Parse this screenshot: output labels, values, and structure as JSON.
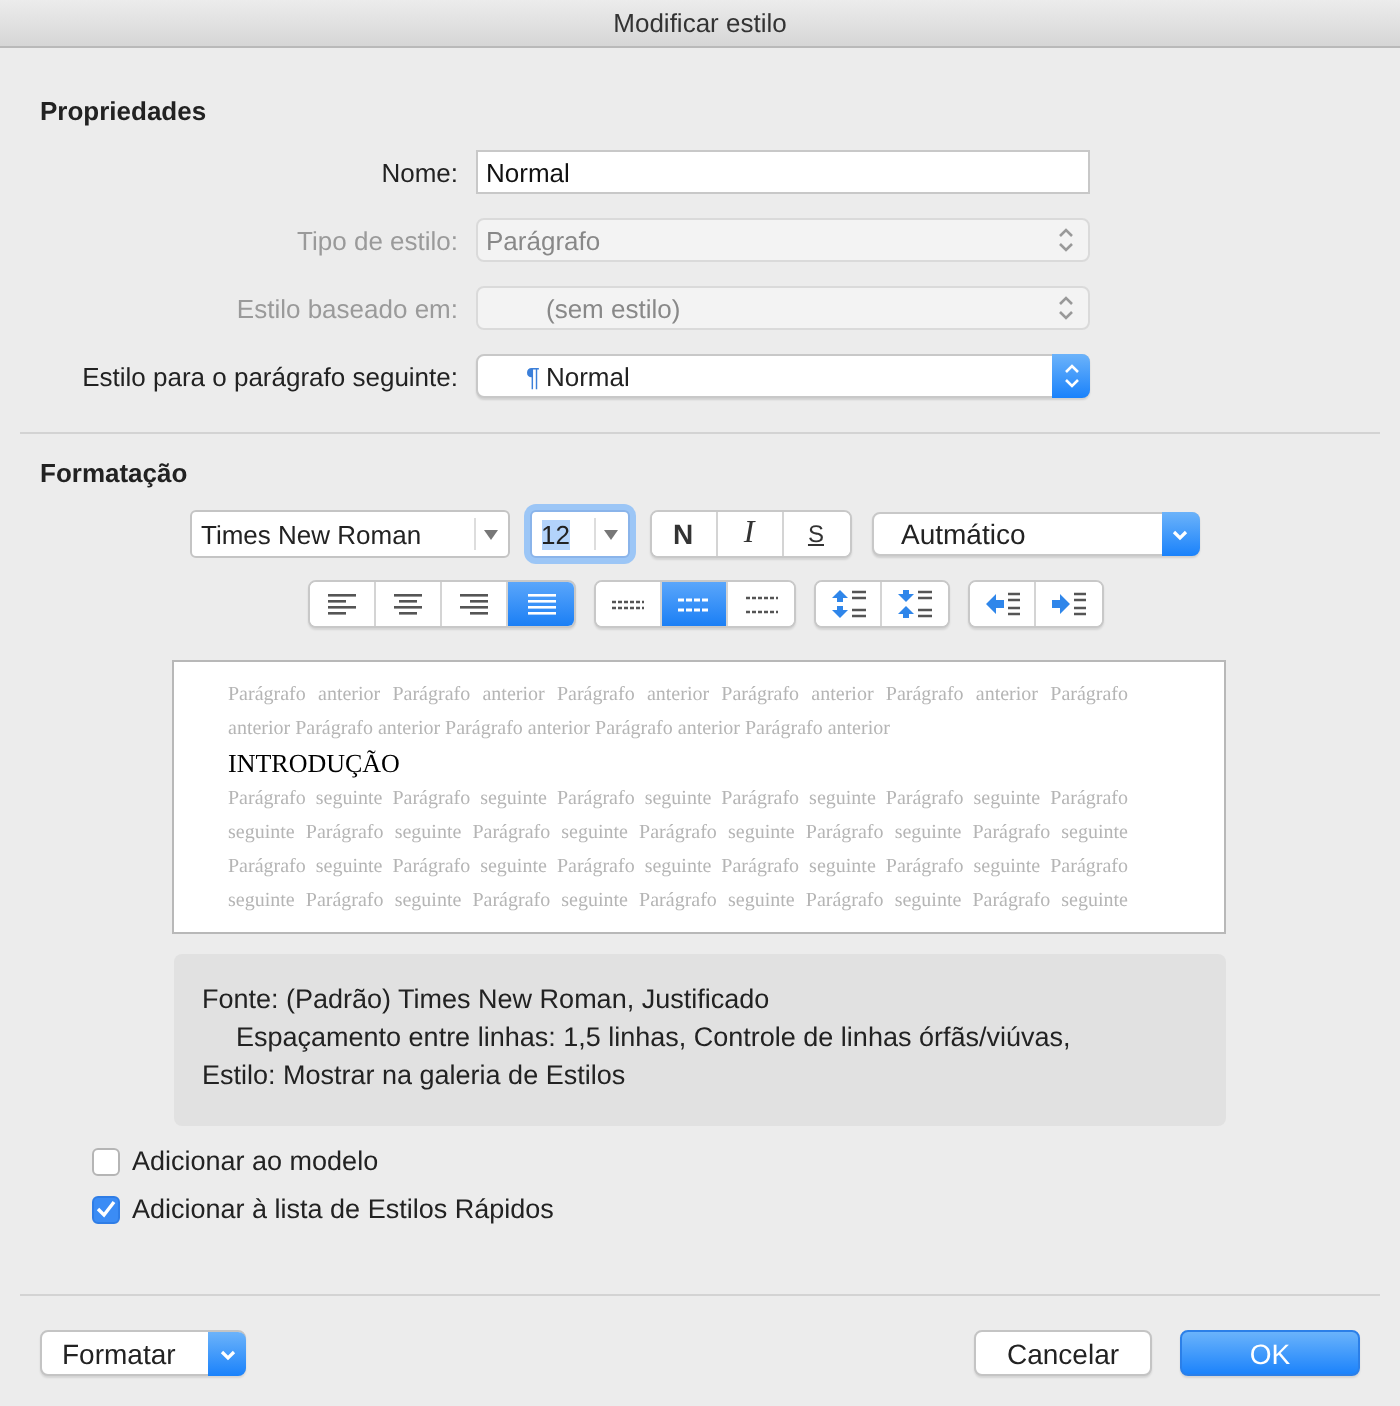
{
  "window": {
    "title": "Modificar estilo"
  },
  "properties": {
    "heading": "Propriedades",
    "fields": [
      {
        "label": "Nome:",
        "kind": "text",
        "value": "Normal"
      },
      {
        "label": "Tipo de estilo:",
        "kind": "select",
        "value": "Parágrafo",
        "disabled": true
      },
      {
        "label": "Estilo baseado em:",
        "kind": "select",
        "value": "(sem estilo)",
        "disabled": true
      },
      {
        "label": "Estilo para o parágrafo seguinte:",
        "kind": "popup",
        "mark": "¶",
        "value": "Normal",
        "disabled": false
      }
    ]
  },
  "formatting": {
    "heading": "Formatação",
    "font_name": "Times New Roman",
    "font_size": "12",
    "style_buttons": [
      {
        "label": "N",
        "kind": "bold",
        "selected": false
      },
      {
        "label": "I",
        "kind": "italic",
        "selected": false
      },
      {
        "label": "S",
        "kind": "underline",
        "selected": false
      }
    ],
    "font_color": "Autmático",
    "alignment": [
      {
        "kind": "left",
        "selected": false
      },
      {
        "kind": "center",
        "selected": false
      },
      {
        "kind": "right",
        "selected": false
      },
      {
        "kind": "justify",
        "selected": true
      }
    ],
    "line_spacing": [
      {
        "kind": "single",
        "selected": false
      },
      {
        "kind": "one-and-half",
        "selected": true
      },
      {
        "kind": "double",
        "selected": false
      }
    ],
    "paragraph_spacing": [
      {
        "kind": "increase"
      },
      {
        "kind": "decrease"
      }
    ],
    "indent": [
      {
        "kind": "decrease"
      },
      {
        "kind": "increase"
      }
    ]
  },
  "preview": {
    "previous_lines": [
      "Parágrafo anterior Parágrafo anterior Parágrafo anterior Parágrafo anterior Parágrafo anterior Parágrafo",
      "anterior Parágrafo anterior Parágrafo anterior Parágrafo anterior Parágrafo anterior"
    ],
    "heading": "INTRODUÇÃO",
    "next_lines": [
      "Parágrafo seguinte Parágrafo seguinte Parágrafo seguinte Parágrafo seguinte Parágrafo seguinte Parágrafo",
      "seguinte Parágrafo seguinte Parágrafo seguinte Parágrafo seguinte Parágrafo seguinte Parágrafo seguinte",
      "Parágrafo seguinte Parágrafo seguinte Parágrafo seguinte Parágrafo seguinte Parágrafo seguinte Parágrafo",
      "seguinte Parágrafo seguinte Parágrafo seguinte Parágrafo seguinte Parágrafo seguinte Parágrafo seguinte"
    ]
  },
  "description": [
    {
      "text": "Fonte: (Padrão) Times New Roman, Justificado",
      "indented": false
    },
    {
      "text": "Espaçamento entre linhas:  1,5 linhas, Controle de linhas órfãs/viúvas,",
      "indented": true
    },
    {
      "text": "Estilo: Mostrar na galeria de Estilos",
      "indented": false
    }
  ],
  "options": [
    {
      "label": "Adicionar ao modelo",
      "checked": false
    },
    {
      "label": "Adicionar à lista de Estilos Rápidos",
      "checked": true
    }
  ],
  "buttons": [
    {
      "label": "Formatar",
      "kind": "menu"
    },
    {
      "label": "Cancelar",
      "kind": "cancel"
    },
    {
      "label": "OK",
      "kind": "default"
    }
  ]
}
